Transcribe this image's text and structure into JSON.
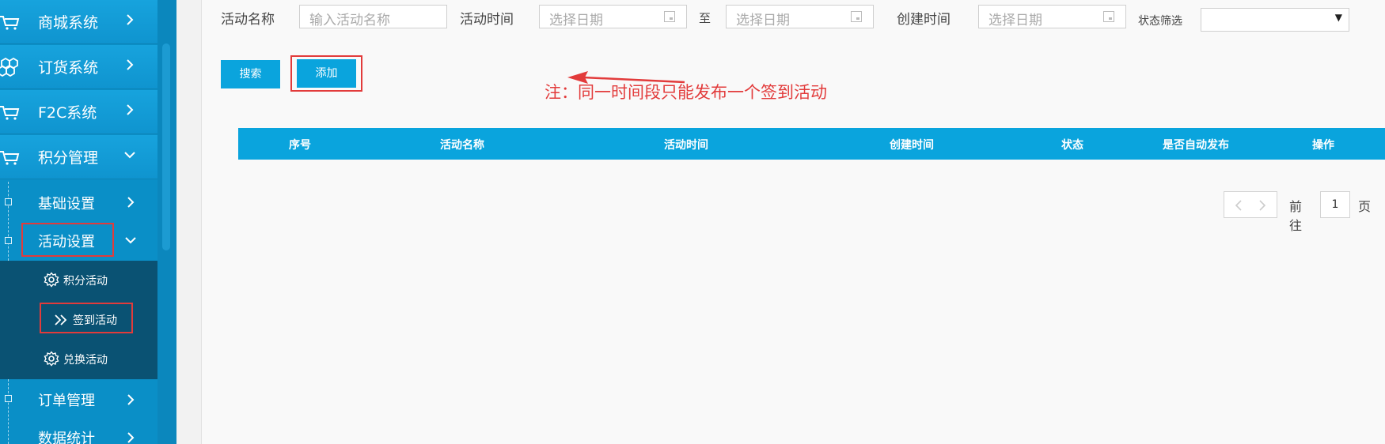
{
  "sidebar": {
    "top_items": [
      {
        "label": "商城系统",
        "icon": "cart-icon"
      },
      {
        "label": "订货系统",
        "icon": "boxes-icon"
      },
      {
        "label": "F2C系统",
        "icon": "cart-icon"
      },
      {
        "label": "积分管理",
        "icon": "cart-icon"
      }
    ],
    "sub_items": [
      {
        "label": "基础设置"
      },
      {
        "label": "活动设置"
      }
    ],
    "activity_items": [
      {
        "label": "积分活动",
        "icon": "gear-icon"
      },
      {
        "label": "签到活动",
        "icon": "double-chevron-icon"
      },
      {
        "label": "兑换活动",
        "icon": "gear-icon"
      }
    ],
    "bottom_items": [
      {
        "label": "订单管理"
      },
      {
        "label": "数据统计"
      }
    ]
  },
  "filters": {
    "name_label": "活动名称",
    "name_placeholder": "输入活动名称",
    "time_label": "活动时间",
    "date_start_placeholder": "选择日期",
    "to_label": "至",
    "date_end_placeholder": "选择日期",
    "created_label": "创建时间",
    "created_placeholder": "选择日期",
    "status_label": "状态筛选",
    "status_value": ""
  },
  "buttons": {
    "search": "搜索",
    "add": "添加"
  },
  "annotation": {
    "note": "注：同一时间段只能发布一个签到活动"
  },
  "table": {
    "columns": [
      "序号",
      "活动名称",
      "活动时间",
      "创建时间",
      "状态",
      "是否自动发布",
      "操作"
    ],
    "rows": []
  },
  "pagination": {
    "goto_label": "前往",
    "page_value": "1",
    "page_unit": "页"
  },
  "colors": {
    "sidebar": "#0a8fc7",
    "accent": "#0aa4dd",
    "highlight": "#e23b3b"
  }
}
